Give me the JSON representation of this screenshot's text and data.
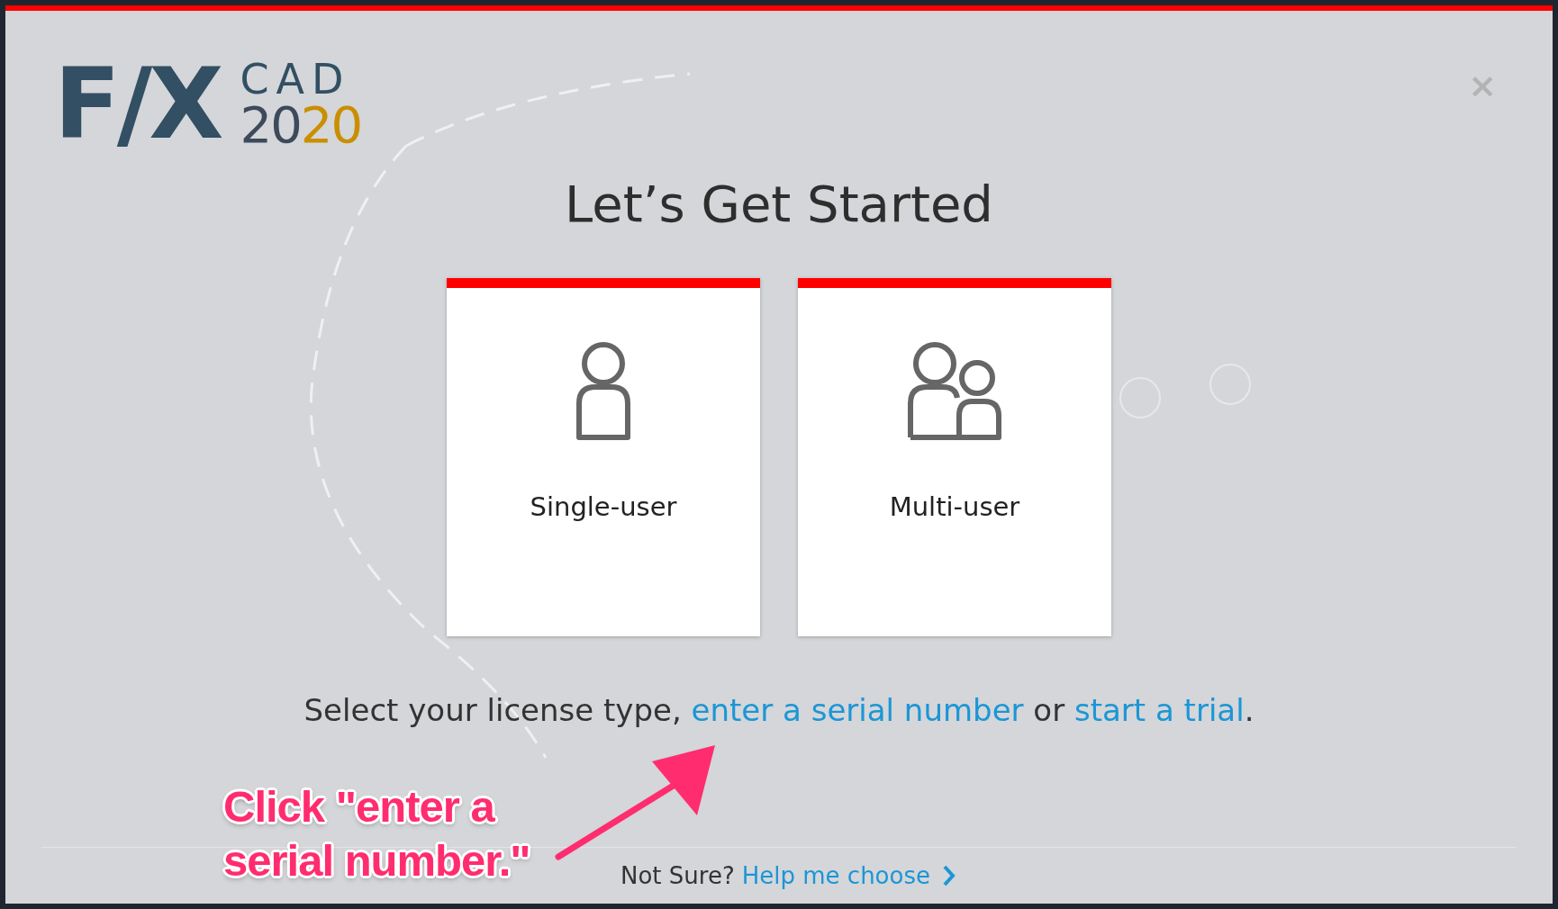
{
  "logo": {
    "brand": "F/X",
    "product": "CAD",
    "year_main": "20",
    "year_accent": "20"
  },
  "close": {
    "label": "×"
  },
  "title": "Let’s Get Started",
  "options": [
    {
      "kind": "single",
      "label": "Single-user"
    },
    {
      "kind": "multi",
      "label": "Multi-user"
    }
  ],
  "instruction": [
    {
      "kind": "text",
      "text": "Select your license type, "
    },
    {
      "kind": "link",
      "text": "enter a serial number"
    },
    {
      "kind": "text",
      "text": " or "
    },
    {
      "kind": "link",
      "text": "start a trial"
    },
    {
      "kind": "text",
      "text": "."
    }
  ],
  "footer": {
    "question": "Not Sure?",
    "link": "Help me choose"
  },
  "annotation": {
    "text": "Click \"enter a serial number.\""
  }
}
